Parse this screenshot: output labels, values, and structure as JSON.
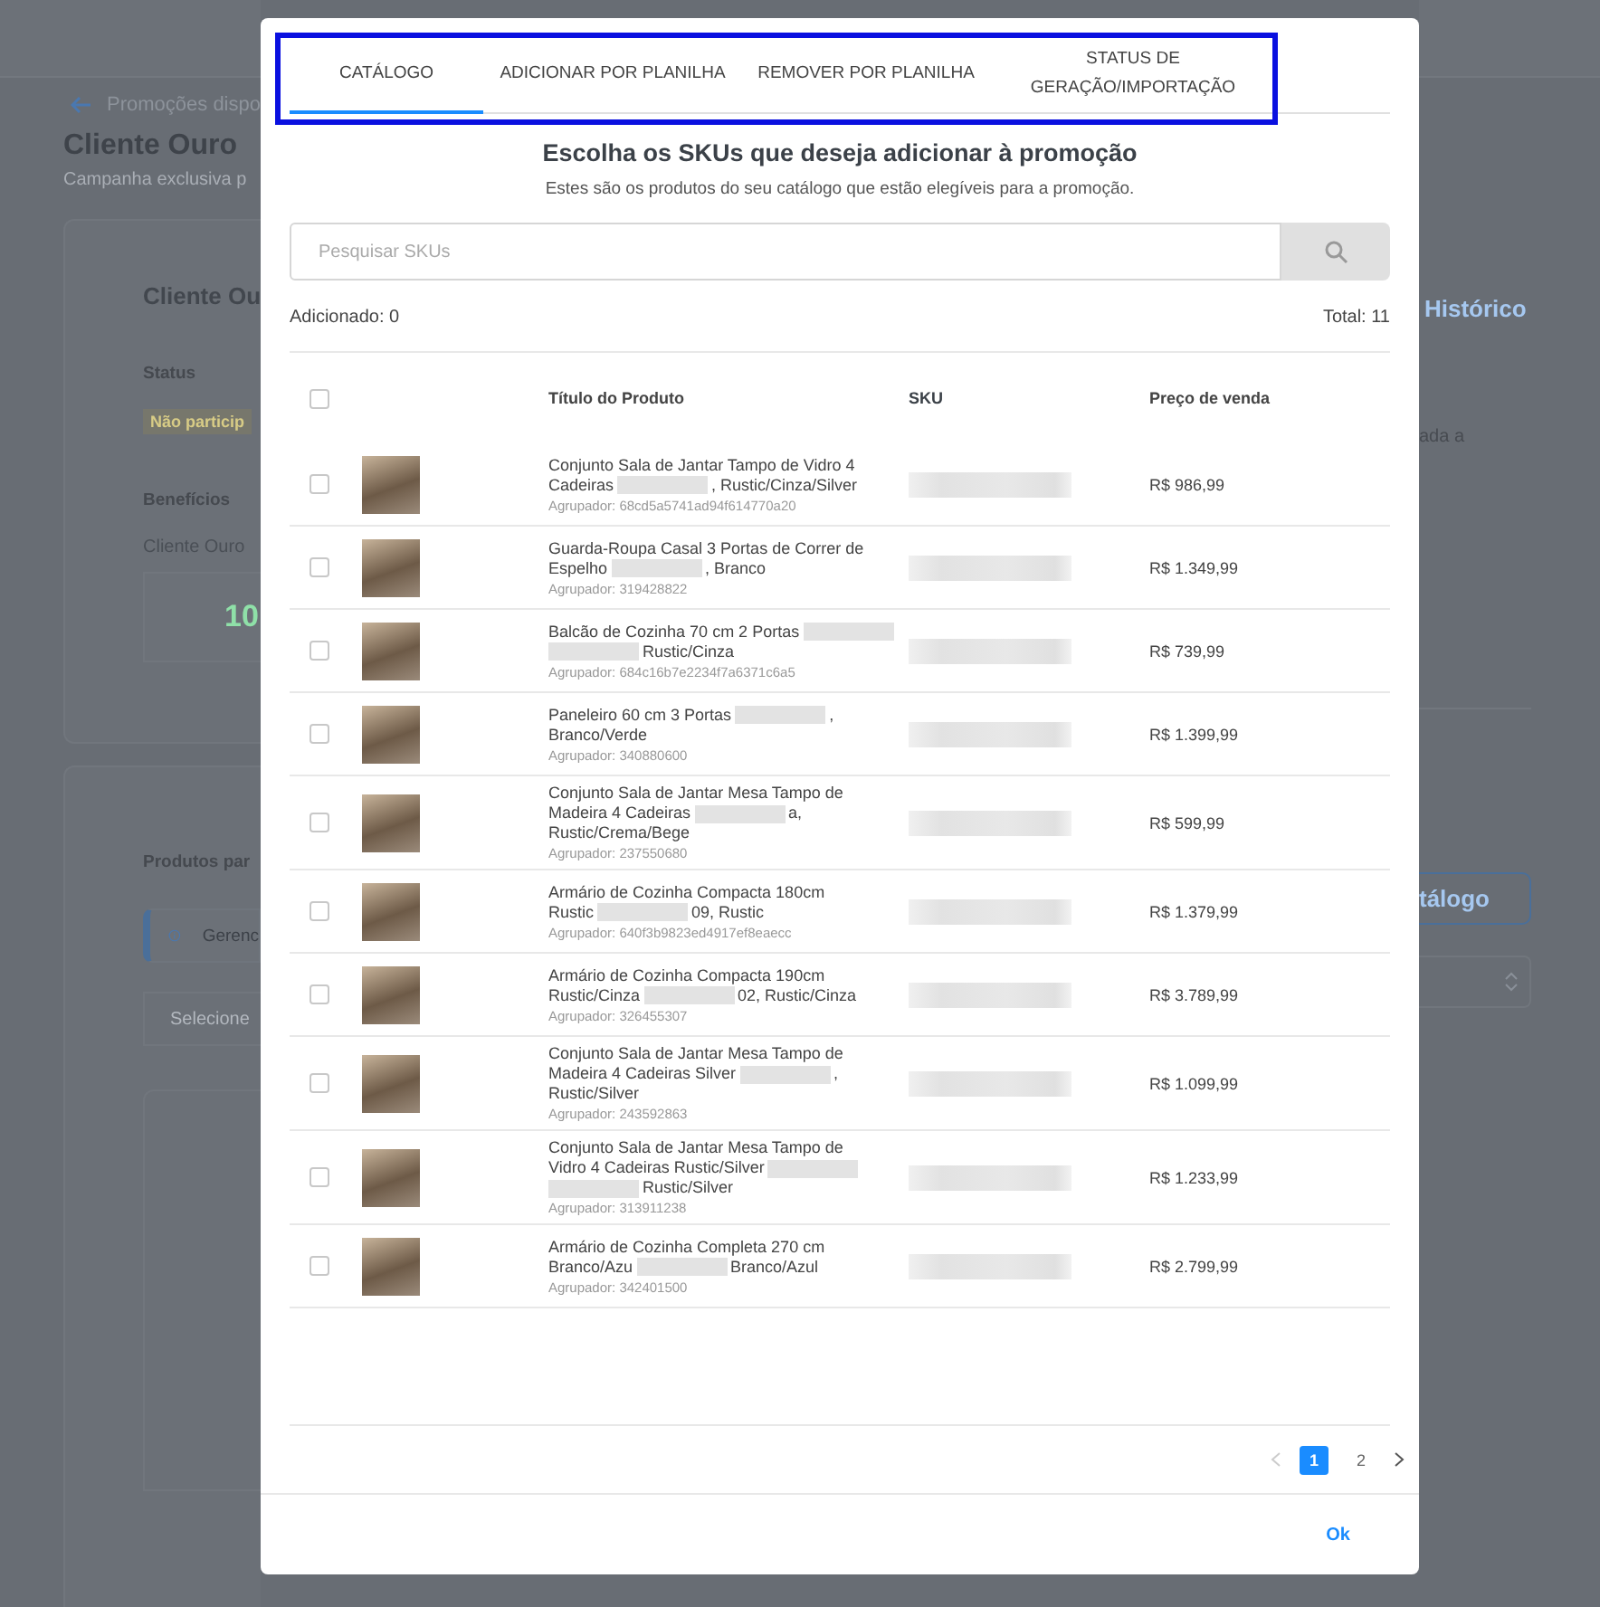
{
  "background_page": {
    "breadcrumb": "Promoções dispo",
    "title": "Cliente Ouro",
    "subtitle": "Campanha exclusiva p",
    "card": {
      "heading": "Cliente Ou",
      "status_label": "Status",
      "status_badge": "Não particip",
      "benefits_label": "Benefícios",
      "benefit_name": "Cliente Ouro",
      "benefit_value": "10",
      "history_link": "Histórico",
      "note": "ada a"
    },
    "products_section": {
      "heading": "Produtos par",
      "info": "Gerenc",
      "catalog_button": "tálogo",
      "select_placeholder": "Selecione"
    }
  },
  "modal": {
    "tabs": [
      {
        "label": "CATÁLOGO",
        "selected": true
      },
      {
        "label": "ADICIONAR POR PLANILHA",
        "selected": false
      },
      {
        "label": "REMOVER POR PLANILHA",
        "selected": false
      },
      {
        "label": "STATUS DE GERAÇÃO/IMPORTAÇÃO",
        "selected": false
      }
    ],
    "title": "Escolha os SKUs que deseja adicionar à promoção",
    "subtitle": "Estes são os produtos do seu catálogo que estão elegíveis para a promoção.",
    "search": {
      "placeholder": "Pesquisar SKUs"
    },
    "added": "Adicionado: 0",
    "total": "Total: 11",
    "table": {
      "columns": [
        "Título do Produto",
        "SKU",
        "Preço de venda"
      ],
      "header_checked": false,
      "rows": [
        {
          "title_lines": [
            [
              {
                "kind": "text",
                "text": "Conjunto Sala de Jantar Tampo de Vidro 4"
              }
            ],
            [
              {
                "kind": "text",
                "text": "Cadeiras"
              },
              {
                "kind": "redacted"
              },
              {
                "kind": "text",
                "text": ", Rustic/Cinza/Silver"
              }
            ]
          ],
          "group": "Agrupador: 68cd5a5741ad94f614770a20",
          "price": "R$ 986,99",
          "checked": false
        },
        {
          "title_lines": [
            [
              {
                "kind": "text",
                "text": "Guarda-Roupa Casal 3 Portas de Correr de"
              }
            ],
            [
              {
                "kind": "text",
                "text": "Espelho"
              },
              {
                "kind": "redacted"
              },
              {
                "kind": "text",
                "text": ", Branco"
              }
            ]
          ],
          "group": "Agrupador: 319428822",
          "price": "R$ 1.349,99",
          "checked": false
        },
        {
          "title_lines": [
            [
              {
                "kind": "text",
                "text": "Balcão de Cozinha 70 cm 2 Portas"
              },
              {
                "kind": "redacted"
              }
            ],
            [
              {
                "kind": "redacted"
              },
              {
                "kind": "text",
                "text": "Rustic/Cinza"
              }
            ]
          ],
          "group": "Agrupador: 684c16b7e2234f7a6371c6a5",
          "price": "R$ 739,99",
          "checked": false
        },
        {
          "title_lines": [
            [
              {
                "kind": "text",
                "text": "Paneleiro 60 cm 3 Portas"
              },
              {
                "kind": "redacted"
              },
              {
                "kind": "text",
                "text": ","
              }
            ],
            [
              {
                "kind": "text",
                "text": "Branco/Verde"
              }
            ]
          ],
          "group": "Agrupador: 340880600",
          "price": "R$ 1.399,99",
          "checked": false
        },
        {
          "title_lines": [
            [
              {
                "kind": "text",
                "text": "Conjunto Sala de Jantar Mesa Tampo de"
              }
            ],
            [
              {
                "kind": "text",
                "text": "Madeira 4 Cadeiras"
              },
              {
                "kind": "redacted"
              },
              {
                "kind": "text",
                "text": "a,"
              }
            ],
            [
              {
                "kind": "text",
                "text": "Rustic/Crema/Bege"
              }
            ]
          ],
          "group": "Agrupador: 237550680",
          "price": "R$ 599,99",
          "checked": false
        },
        {
          "title_lines": [
            [
              {
                "kind": "text",
                "text": "Armário de Cozinha Compacta 180cm"
              }
            ],
            [
              {
                "kind": "text",
                "text": "Rustic"
              },
              {
                "kind": "redacted"
              },
              {
                "kind": "text",
                "text": "09, Rustic"
              }
            ]
          ],
          "group": "Agrupador: 640f3b9823ed4917ef8eaecc",
          "price": "R$ 1.379,99",
          "checked": false
        },
        {
          "title_lines": [
            [
              {
                "kind": "text",
                "text": "Armário de Cozinha Compacta 190cm"
              }
            ],
            [
              {
                "kind": "text",
                "text": "Rustic/Cinza"
              },
              {
                "kind": "redacted"
              },
              {
                "kind": "text",
                "text": "02, Rustic/Cinza"
              }
            ]
          ],
          "group": "Agrupador: 326455307",
          "price": "R$ 3.789,99",
          "checked": false
        },
        {
          "title_lines": [
            [
              {
                "kind": "text",
                "text": "Conjunto Sala de Jantar Mesa Tampo de"
              }
            ],
            [
              {
                "kind": "text",
                "text": "Madeira 4 Cadeiras Silver"
              },
              {
                "kind": "redacted"
              },
              {
                "kind": "text",
                "text": ","
              }
            ],
            [
              {
                "kind": "text",
                "text": "Rustic/Silver"
              }
            ]
          ],
          "group": "Agrupador: 243592863",
          "price": "R$ 1.099,99",
          "checked": false
        },
        {
          "title_lines": [
            [
              {
                "kind": "text",
                "text": "Conjunto Sala de Jantar Mesa Tampo de"
              }
            ],
            [
              {
                "kind": "text",
                "text": "Vidro 4 Cadeiras Rustic/Silver"
              },
              {
                "kind": "redacted"
              }
            ],
            [
              {
                "kind": "redacted"
              },
              {
                "kind": "text",
                "text": "Rustic/Silver"
              }
            ]
          ],
          "group": "Agrupador: 313911238",
          "price": "R$ 1.233,99",
          "checked": false
        },
        {
          "title_lines": [
            [
              {
                "kind": "text",
                "text": "Armário de Cozinha Completa 270 cm"
              }
            ],
            [
              {
                "kind": "text",
                "text": "Branco/Azu"
              },
              {
                "kind": "redacted"
              },
              {
                "kind": "text",
                "text": "Branco/Azul"
              }
            ]
          ],
          "group": "Agrupador: 342401500",
          "price": "R$ 2.799,99",
          "checked": false
        }
      ]
    },
    "pagination": {
      "pages": [
        {
          "label": "1",
          "selected": true
        },
        {
          "label": "2",
          "selected": false
        }
      ]
    },
    "ok_button": "Ok"
  }
}
